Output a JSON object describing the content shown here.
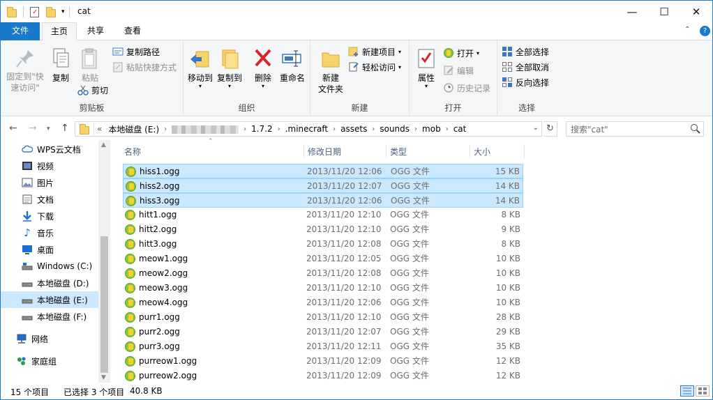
{
  "window": {
    "title": "cat",
    "minimize_glyph": "—",
    "maximize_glyph": "☐",
    "close_glyph": "✕"
  },
  "tabs": {
    "file": "文件",
    "home": "主页",
    "share": "共享",
    "view": "查看"
  },
  "ribbon": {
    "clipboard": {
      "label": "剪贴板",
      "pin": "固定到\"快\n速访问\"",
      "copy": "复制",
      "paste": "粘贴",
      "copy_path": "复制路径",
      "paste_shortcut": "粘贴快捷方式",
      "cut": "剪切"
    },
    "organize": {
      "label": "组织",
      "move_to": "移动到",
      "copy_to": "复制到",
      "delete": "删除",
      "rename": "重命名"
    },
    "new": {
      "label": "新建",
      "new_folder": "新建\n文件夹",
      "new_item": "新建项目",
      "easy_access": "轻松访问"
    },
    "open": {
      "label": "打开",
      "properties": "属性",
      "open": "打开",
      "edit": "编辑",
      "history": "历史记录"
    },
    "select": {
      "label": "选择",
      "select_all": "全部选择",
      "select_none": "全部取消",
      "invert": "反向选择"
    }
  },
  "address": {
    "crumbs": [
      "本地磁盘 (E:)",
      "",
      "1.7.2",
      ".minecraft",
      "assets",
      "sounds",
      "mob",
      "cat"
    ],
    "overflow": "«",
    "search_placeholder": "搜索\"cat\""
  },
  "nav": {
    "items": [
      {
        "label": "WPS云文档",
        "icon": "cloud-icon"
      },
      {
        "label": "视频",
        "icon": "video-icon"
      },
      {
        "label": "图片",
        "icon": "picture-icon"
      },
      {
        "label": "文档",
        "icon": "document-icon"
      },
      {
        "label": "下载",
        "icon": "download-icon"
      },
      {
        "label": "音乐",
        "icon": "music-icon"
      },
      {
        "label": "桌面",
        "icon": "desktop-icon"
      },
      {
        "label": "Windows (C:)",
        "icon": "drive-icon"
      },
      {
        "label": "本地磁盘 (D:)",
        "icon": "drive-icon"
      },
      {
        "label": "本地磁盘 (E:)",
        "icon": "drive-icon"
      },
      {
        "label": "本地磁盘 (F:)",
        "icon": "drive-icon"
      },
      {
        "label": "网络",
        "icon": "network-icon"
      },
      {
        "label": "家庭组",
        "icon": "homegroup-icon"
      }
    ]
  },
  "columns": {
    "name": "名称",
    "date": "修改日期",
    "type": "类型",
    "size": "大小"
  },
  "files": [
    {
      "name": "hiss1.ogg",
      "date": "2013/11/20 12:06",
      "type": "OGG 文件",
      "size": "15 KB",
      "selected": true
    },
    {
      "name": "hiss2.ogg",
      "date": "2013/11/20 12:07",
      "type": "OGG 文件",
      "size": "14 KB",
      "selected": true
    },
    {
      "name": "hiss3.ogg",
      "date": "2013/11/20 12:06",
      "type": "OGG 文件",
      "size": "14 KB",
      "selected": true
    },
    {
      "name": "hitt1.ogg",
      "date": "2013/11/20 12:10",
      "type": "OGG 文件",
      "size": "8 KB",
      "selected": false
    },
    {
      "name": "hitt2.ogg",
      "date": "2013/11/20 12:10",
      "type": "OGG 文件",
      "size": "9 KB",
      "selected": false
    },
    {
      "name": "hitt3.ogg",
      "date": "2013/11/20 12:08",
      "type": "OGG 文件",
      "size": "8 KB",
      "selected": false
    },
    {
      "name": "meow1.ogg",
      "date": "2013/11/20 12:05",
      "type": "OGG 文件",
      "size": "10 KB",
      "selected": false
    },
    {
      "name": "meow2.ogg",
      "date": "2013/11/20 12:08",
      "type": "OGG 文件",
      "size": "10 KB",
      "selected": false
    },
    {
      "name": "meow3.ogg",
      "date": "2013/11/20 12:10",
      "type": "OGG 文件",
      "size": "10 KB",
      "selected": false
    },
    {
      "name": "meow4.ogg",
      "date": "2013/11/20 12:06",
      "type": "OGG 文件",
      "size": "10 KB",
      "selected": false
    },
    {
      "name": "purr1.ogg",
      "date": "2013/11/20 12:10",
      "type": "OGG 文件",
      "size": "28 KB",
      "selected": false
    },
    {
      "name": "purr2.ogg",
      "date": "2013/11/20 12:07",
      "type": "OGG 文件",
      "size": "29 KB",
      "selected": false
    },
    {
      "name": "purr3.ogg",
      "date": "2013/11/20 12:11",
      "type": "OGG 文件",
      "size": "35 KB",
      "selected": false
    },
    {
      "name": "purreow1.ogg",
      "date": "2013/11/20 12:09",
      "type": "OGG 文件",
      "size": "12 KB",
      "selected": false
    },
    {
      "name": "purreow2.ogg",
      "date": "2013/11/20 12:09",
      "type": "OGG 文件",
      "size": "12 KB",
      "selected": false
    }
  ],
  "status": {
    "count": "15 个项目",
    "selected": "已选择 3 个项目",
    "size": "40.8 KB"
  },
  "colors": {
    "accent": "#1979ca",
    "selection": "#cce8ff",
    "selection_border": "#99d1ff"
  }
}
